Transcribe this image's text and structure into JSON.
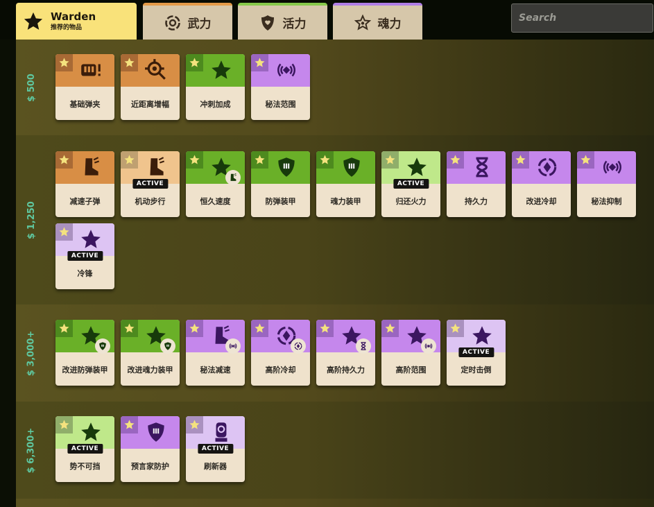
{
  "header": {
    "hero_tab": {
      "name": "Warden",
      "subtitle": "推荐的物品",
      "icon": "star-icon"
    },
    "category_tabs": [
      {
        "label": "武力",
        "icon": "weapon-ring-icon",
        "accent": "#e39a48"
      },
      {
        "label": "活力",
        "icon": "vitality-shield-icon",
        "accent": "#86c94a"
      },
      {
        "label": "魂力",
        "icon": "spirit-star-icon",
        "accent": "#b07ee6"
      }
    ],
    "search": {
      "placeholder": "Search",
      "value": "",
      "clear_label": "×"
    }
  },
  "badge_text": "ACTIVE",
  "tiers": [
    {
      "cost": "500",
      "items": [
        {
          "name": "基础弹夹",
          "category": "weapon",
          "icon": "magazine-icon",
          "active": false
        },
        {
          "name": "近距离增幅",
          "category": "weapon",
          "icon": "crosshair-magnifier-icon",
          "active": false
        },
        {
          "name": "冲刺加成",
          "category": "vitality",
          "icon": "sprint-leg-icon",
          "active": false
        },
        {
          "name": "秘法范围",
          "category": "spirit",
          "icon": "signal-diamond-icon",
          "active": false
        }
      ]
    },
    {
      "cost": "1,250",
      "items": [
        {
          "name": "减速子弹",
          "category": "weapon",
          "icon": "slow-boot-icon",
          "active": false
        },
        {
          "name": "机动步行",
          "category": "weapon",
          "icon": "winged-boot-icon",
          "active": true
        },
        {
          "name": "恒久速度",
          "category": "vitality",
          "icon": "speed-legs-icon",
          "sub_icon": "slow-boot-icon",
          "active": false
        },
        {
          "name": "防弹装甲",
          "category": "vitality",
          "icon": "bullet-shield-icon",
          "active": false
        },
        {
          "name": "魂力装甲",
          "category": "vitality",
          "icon": "spirit-shield-icon",
          "active": false
        },
        {
          "name": "归还火力",
          "category": "vitality",
          "icon": "return-fire-icon",
          "active": true
        },
        {
          "name": "持久力",
          "category": "spirit",
          "icon": "hourglass-icon",
          "active": false
        },
        {
          "name": "改进冷却",
          "category": "spirit",
          "icon": "cooldown-cycle-icon",
          "active": false
        },
        {
          "name": "秘法抑制",
          "category": "spirit",
          "icon": "arcane-suppress-icon",
          "active": false
        },
        {
          "name": "冷锋",
          "category": "spirit",
          "icon": "cold-front-icon",
          "active": true
        }
      ]
    },
    {
      "cost": "3,000+",
      "items": [
        {
          "name": "改进防弹装甲",
          "category": "vitality",
          "icon": "armored-figure-icon",
          "sub_icon": "bullet-shield-icon",
          "active": false
        },
        {
          "name": "改进魂力装甲",
          "category": "vitality",
          "icon": "spirit-armor-figure-icon",
          "sub_icon": "spirit-shield-icon",
          "active": false
        },
        {
          "name": "秘法减速",
          "category": "spirit",
          "icon": "arcane-slow-boot-icon",
          "sub_icon": "arcane-suppress-icon",
          "active": false
        },
        {
          "name": "高阶冷却",
          "category": "spirit",
          "icon": "swirl-flower-icon",
          "sub_icon": "cooldown-cycle-icon",
          "active": false
        },
        {
          "name": "高阶持久力",
          "category": "spirit",
          "icon": "ornate-frame-icon",
          "sub_icon": "hourglass-icon",
          "active": false
        },
        {
          "name": "高阶范围",
          "category": "spirit",
          "icon": "winged-emblem-icon",
          "sub_icon": "signal-diamond-icon",
          "active": false
        },
        {
          "name": "定时击倒",
          "category": "spirit",
          "icon": "knockdown-hand-icon",
          "active": true
        }
      ]
    },
    {
      "cost": "6,300+",
      "items": [
        {
          "name": "势不可挡",
          "category": "vitality",
          "icon": "unstoppable-icon",
          "active": true
        },
        {
          "name": "预言家防护",
          "category": "spirit",
          "icon": "seer-shield-icon",
          "active": false
        },
        {
          "name": "刷新器",
          "category": "spirit",
          "icon": "refresher-icon",
          "active": true
        }
      ]
    }
  ]
}
